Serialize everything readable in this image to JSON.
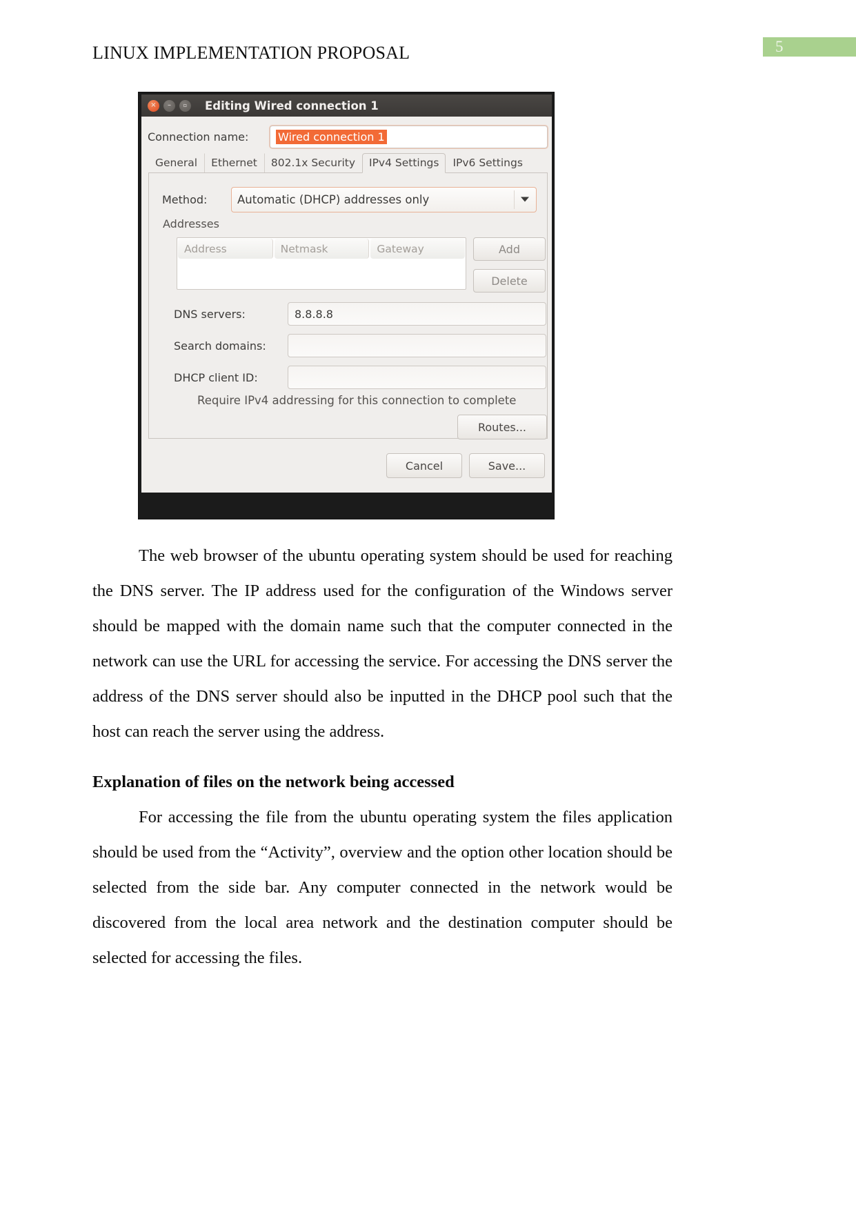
{
  "header": {
    "running_head": "LINUX IMPLEMENTATION PROPOSAL",
    "page_number": "5",
    "badge_color": "#a9d18e"
  },
  "figure": {
    "window_title": "Editing Wired connection 1",
    "window_controls": {
      "close": "×",
      "minimize": "–",
      "maximize": "▫"
    },
    "connection_name": {
      "label": "Connection name:",
      "value": "Wired connection 1",
      "selection_color": "#f26a36"
    },
    "tabs": [
      {
        "label": "General",
        "active": false
      },
      {
        "label": "Ethernet",
        "active": false
      },
      {
        "label": "802.1x Security",
        "active": false
      },
      {
        "label": "IPv4 Settings",
        "active": true
      },
      {
        "label": "IPv6 Settings",
        "active": false
      }
    ],
    "method": {
      "label": "Method:",
      "value": "Automatic (DHCP) addresses only"
    },
    "addresses": {
      "section_label": "Addresses",
      "columns": [
        "Address",
        "Netmask",
        "Gateway"
      ],
      "rows": [],
      "add_button": "Add",
      "delete_button": "Delete"
    },
    "fields": [
      {
        "label": "DNS servers:",
        "value": "8.8.8.8"
      },
      {
        "label": "Search domains:",
        "value": ""
      },
      {
        "label": "DHCP client ID:",
        "value": ""
      }
    ],
    "require_text": "Require IPv4 addressing for this connection to complete",
    "routes_button": "Routes...",
    "cancel_button": "Cancel",
    "save_button": "Save..."
  },
  "content": {
    "paragraph_1": "The web browser of the ubuntu operating system should be used for reaching the DNS server. The IP address used for the configuration of the Windows server should be mapped with the domain name such that the computer connected in the network can use the URL for accessing the service. For accessing the DNS server the address of the DNS server should also be inputted in the DHCP pool such that the host can reach the server using the address.",
    "sub_heading": "Explanation of files on the network being accessed",
    "paragraph_2": "For accessing the file from the ubuntu operating system the files application should be used from the “Activity”, overview and the option other location should be selected from the side bar. Any computer connected in the network would be discovered from the local area network and the destination computer should be selected for accessing the files."
  }
}
